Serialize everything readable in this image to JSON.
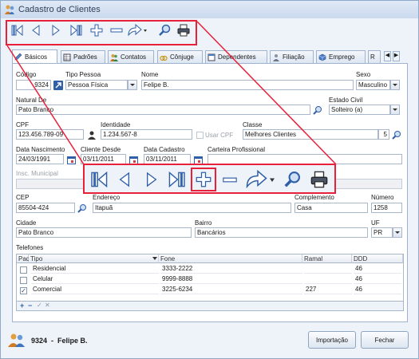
{
  "window": {
    "title": "Cadastro de Clientes"
  },
  "toolbar": {
    "items": [
      "first-icon",
      "prev-icon",
      "next-icon",
      "last-icon",
      "add-icon",
      "remove-icon",
      "redo-icon",
      "dropdown-arrow-icon",
      "search-icon",
      "print-icon"
    ]
  },
  "tabs": [
    {
      "label": "Básicos",
      "active": true,
      "icon": "pencil-icon"
    },
    {
      "label": "Padrões",
      "icon": "grid-icon"
    },
    {
      "label": "Contatos",
      "icon": "people-icon"
    },
    {
      "label": "Cônjuge",
      "icon": "rings-icon"
    },
    {
      "label": "Dependentes",
      "icon": "table-icon"
    },
    {
      "label": "Filiação",
      "icon": "person-icon"
    },
    {
      "label": "Emprego",
      "icon": "cube-icon"
    },
    {
      "label": "R"
    }
  ],
  "form": {
    "codigo": {
      "label": "Código",
      "value": "9324"
    },
    "tipo_pessoa": {
      "label": "Tipo Pessoa",
      "value": "Pessoa Física"
    },
    "nome": {
      "label": "Nome",
      "value": "Felipe B."
    },
    "sexo": {
      "label": "Sexo",
      "value": "Masculino"
    },
    "natural_de": {
      "label": "Natural De",
      "value": "Pato Branco"
    },
    "estado_civil": {
      "label": "Estado Civil",
      "value": "Solteiro (a)"
    },
    "cpf": {
      "label": "CPF",
      "value": "123.456.789-09"
    },
    "identidade": {
      "label": "Identidade",
      "value": "1.234.567-8"
    },
    "usar_cpf": {
      "label": "Usar CPF"
    },
    "classe": {
      "label": "Classe",
      "value": "Melhores Clientes",
      "number": "5"
    },
    "data_nascimento": {
      "label": "Data Nascimento",
      "value": "24/03/1991"
    },
    "cliente_desde": {
      "label": "Cliente Desde",
      "value": "03/11/2011"
    },
    "data_cadastro": {
      "label": "Data Cadastro",
      "value": "03/11/2011"
    },
    "carteira_profissional": {
      "label": "Carteira Profissional",
      "value": ""
    },
    "insc_municipal": {
      "label": "Insc. Municipal",
      "value": ""
    },
    "cep": {
      "label": "CEP",
      "value": "85504-424"
    },
    "endereco": {
      "label": "Endereço",
      "value": "Itapuã"
    },
    "complemento": {
      "label": "Complemento",
      "value": "Casa"
    },
    "numero": {
      "label": "Número",
      "value": "1258"
    },
    "cidade": {
      "label": "Cidade",
      "value": "Pato Branco"
    },
    "bairro": {
      "label": "Bairro",
      "value": "Bancários"
    },
    "uf": {
      "label": "UF",
      "value": "PR"
    }
  },
  "telefones": {
    "label": "Telefones",
    "columns": [
      "Padrã",
      "Tipo",
      "Fone",
      "Ramal",
      "DDD"
    ],
    "rows": [
      {
        "padrao": false,
        "tipo": "Residencial",
        "fone": "3333-2222",
        "ramal": "",
        "ddd": "46"
      },
      {
        "padrao": false,
        "tipo": "Celular",
        "fone": "9999-8888",
        "ramal": "",
        "ddd": "46"
      },
      {
        "padrao": true,
        "tipo": "Comercial",
        "fone": "3225-6234",
        "ramal": "227",
        "ddd": "46"
      }
    ],
    "nav_symbols": [
      "+",
      "−",
      "✓",
      "✕"
    ]
  },
  "footer": {
    "code": "9324",
    "separator": "-",
    "name": "Felipe B.",
    "import_label": "Importação",
    "close_label": "Fechar"
  },
  "accent_color": "#e8203a"
}
